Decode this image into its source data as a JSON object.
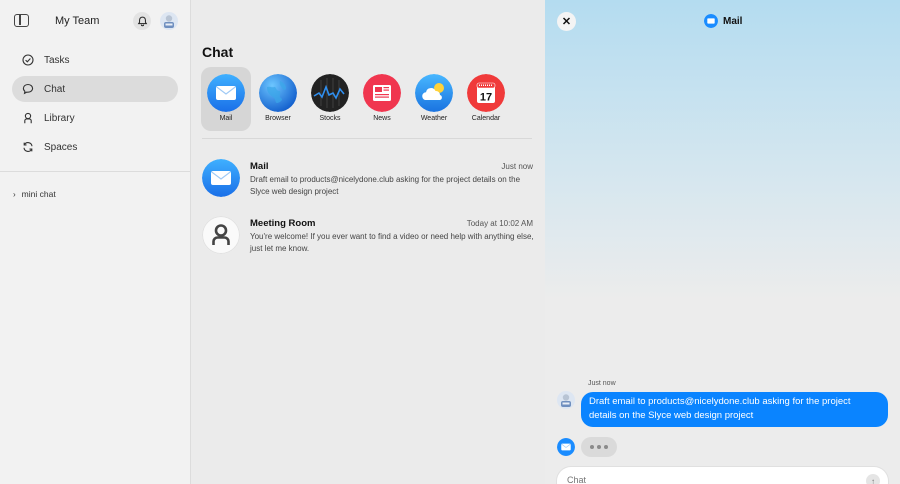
{
  "sidebar": {
    "team_name": "My Team",
    "toggle_icon": "sidebar-toggle-icon",
    "bell_icon": "bell-icon",
    "items": [
      {
        "label": "Tasks",
        "icon": "checkmark-circle-icon",
        "active": false
      },
      {
        "label": "Chat",
        "icon": "chat-bubble-icon",
        "active": true
      },
      {
        "label": "Library",
        "icon": "person-icon",
        "active": false
      },
      {
        "label": "Spaces",
        "icon": "refresh-icon",
        "active": false
      }
    ],
    "mini_chat": "mini chat"
  },
  "main": {
    "title": "Chat",
    "apps": [
      {
        "label": "Mail",
        "icon": "mail-icon",
        "selected": true
      },
      {
        "label": "Browser",
        "icon": "globe-icon",
        "selected": false
      },
      {
        "label": "Stocks",
        "icon": "stocks-icon",
        "selected": false
      },
      {
        "label": "News",
        "icon": "news-icon",
        "selected": false
      },
      {
        "label": "Weather",
        "icon": "weather-icon",
        "selected": false
      },
      {
        "label": "Calendar",
        "icon": "calendar-icon",
        "selected": false,
        "day": "17"
      }
    ],
    "conversations": [
      {
        "name": "Mail",
        "time": "Just now",
        "text": "Draft email to products@nicelydone.club asking for the project details on the Slyce web design project"
      },
      {
        "name": "Meeting Room",
        "time": "Today at 10:02 AM",
        "text": "You're welcome! If you ever want to find a video or need help with anything else, just let me know."
      }
    ]
  },
  "panel": {
    "title": "Mail",
    "close_icon": "close-icon",
    "timestamp": "Just now",
    "user_message": "Draft email to products@nicelydone.club asking for the project details on the Slyce web design project",
    "input_placeholder": "Chat",
    "send_icon": "send-arrow-icon"
  },
  "colors": {
    "accent": "#0a84ff",
    "mail_blue": "#1a8cff",
    "news_red": "#f0364f",
    "calendar_red": "#f03a3a"
  }
}
